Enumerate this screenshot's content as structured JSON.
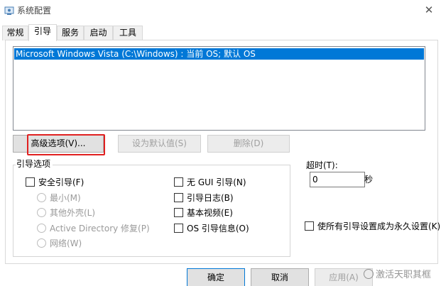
{
  "window": {
    "title": "系统配置",
    "close_glyph": "✕"
  },
  "tabs": [
    {
      "label": "常规",
      "active": false
    },
    {
      "label": "引导",
      "active": true
    },
    {
      "label": "服务",
      "active": false
    },
    {
      "label": "启动",
      "active": false
    },
    {
      "label": "工具",
      "active": false
    }
  ],
  "boot_list": {
    "items": [
      "Microsoft Windows Vista (C:\\Windows) : 当前 OS; 默认 OS"
    ],
    "selected_index": 0
  },
  "buttons": {
    "advanced": "高级选项(V)...",
    "set_default": "设为默认值(S)",
    "delete": "删除(D)"
  },
  "boot_options": {
    "legend": "引导选项",
    "safe_boot": "安全引导(F)",
    "minimal": "最小(M)",
    "alternate_shell": "其他外壳(L)",
    "active_directory": "Active Directory 修复(P)",
    "network": "网络(W)",
    "no_gui": "无 GUI 引导(N)",
    "boot_log": "引导日志(B)",
    "base_video": "基本视频(E)",
    "os_boot_info": "OS 引导信息(O)"
  },
  "timeout": {
    "label": "超时(T):",
    "value": "0",
    "unit": "秒"
  },
  "permanent": {
    "label": "使所有引导设置成为永久设置(K)"
  },
  "footer": {
    "ok": "确定",
    "cancel": "取消",
    "apply": "应用(A)"
  },
  "watermark": {
    "text": "激活天职其框"
  },
  "colors": {
    "selection": "#0078d7",
    "highlight": "#e02020"
  }
}
